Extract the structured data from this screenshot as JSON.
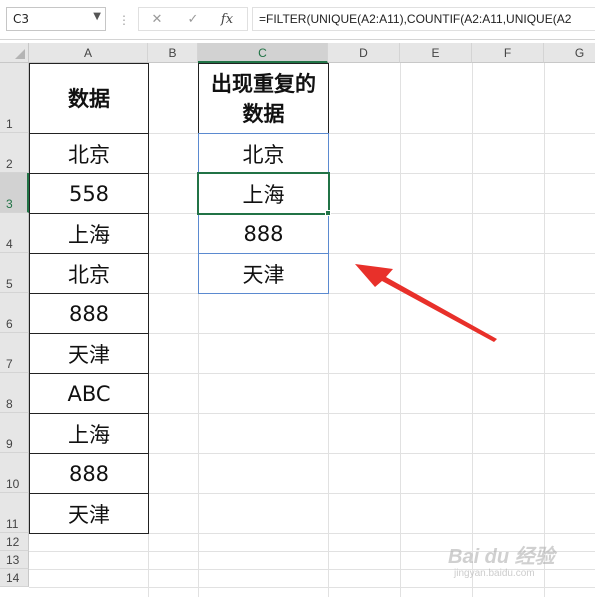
{
  "formula_bar": {
    "name_box": "C3",
    "cancel_icon": "✕",
    "enter_icon": "✓",
    "fx_label": "fx",
    "formula": "=FILTER(UNIQUE(A2:A11),COUNTIF(A2:A11,UNIQUE(A2"
  },
  "columns": [
    "A",
    "B",
    "C",
    "D",
    "E",
    "F",
    "G"
  ],
  "rows": [
    "1",
    "2",
    "3",
    "4",
    "5",
    "6",
    "7",
    "8",
    "9",
    "10",
    "11",
    "12",
    "13",
    "14"
  ],
  "selected": {
    "column": "C",
    "row": "3"
  },
  "column_a": {
    "header": "数据",
    "values": [
      "北京",
      "558",
      "上海",
      "北京",
      "888",
      "天津",
      "ABC",
      "上海",
      "888",
      "天津"
    ]
  },
  "column_c": {
    "header": "出现重复的数据",
    "values": [
      "北京",
      "上海",
      "888",
      "天津"
    ]
  },
  "annotation": {
    "arrow_color": "#e8302a"
  },
  "watermark": {
    "brand": "Bai du 经验",
    "url": "jingyan.baidu.com"
  },
  "colors": {
    "selection": "#217346",
    "cell_border_blue": "#5b8ad0",
    "header_bg": "#e6e6e6"
  }
}
